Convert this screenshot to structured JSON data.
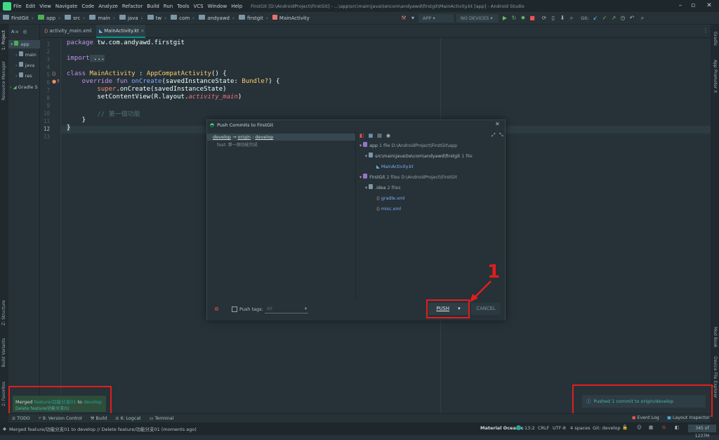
{
  "menu": {
    "items": [
      "File",
      "Edit",
      "View",
      "Navigate",
      "Code",
      "Analyze",
      "Refactor",
      "Build",
      "Run",
      "Tools",
      "VCS",
      "Window",
      "Help"
    ],
    "title": "FirstGit [D:\\AndroidProject\\FirstGit] - ...\\app\\src\\main\\java\\tw\\com\\andyawd\\firstgit\\MainActivity.kt [app] - Android Studio"
  },
  "breadcrumb": [
    "FirstGit",
    "app",
    "src",
    "main",
    "java",
    "tw",
    "com",
    "andyawd",
    "firstgit",
    "MainActivity"
  ],
  "toolbar": {
    "run_config": "APP",
    "device": "NO DEVICES",
    "git_label": "Git:"
  },
  "left_stripe": {
    "project": "1: Project",
    "resource_manager": "Resource Manager",
    "structure": "Z: Structure",
    "build_variants": "Build Variants",
    "favorites": "2: Favorites"
  },
  "right_stripe": {
    "gradle": "Gradle",
    "app_promoter": "App Promoter X",
    "modbook": "Mod Book",
    "device_file_explorer": "Device File Explorer"
  },
  "project_panel": {
    "header": "A:v",
    "items": [
      "app",
      "main",
      "java",
      "res",
      "Gradle S"
    ]
  },
  "tabs": [
    "activity_main.xml",
    "MainActivity.kt"
  ],
  "editor": {
    "line_numbers": [
      "1",
      "2",
      "3",
      "4",
      "5",
      "6",
      "7",
      "8",
      "9",
      "10",
      "11",
      "12",
      "13"
    ],
    "l1_kw": "package",
    "l1_rest": " tw.com.andyawd.firstgit",
    "l3_kw": "import",
    "l3_rest": " ...",
    "l6_kw": "class",
    "l6_cls": " MainActivity",
    "l6_rest": " : ",
    "l6_sup": "AppCompatActivity",
    "l6_end": "() {",
    "l7_kw": "    override fun",
    "l7_fn": " onCreate",
    "l7_rest": "(savedInstanceState: ",
    "l7_ty": "Bundle?",
    "l7_end": ") {",
    "l8_kw": "        super",
    "l8_rest": ".onCreate(savedInstanceState)",
    "l9_rest": "        setContentView(R.layout.",
    "l9_it": "activity_main",
    "l9_end": ")",
    "l11_cm": "        // 第一個功能",
    "l12": "    }",
    "l13": "}"
  },
  "dialog": {
    "title": "Push Commits to FirstGit",
    "branch_from": "develop",
    "branch_arrow": " → ",
    "branch_remote": "origin",
    "branch_sep": " : ",
    "branch_to": "develop",
    "commit": "feat: 第一個功能完成",
    "tree": [
      {
        "name": "app",
        "info": "1 file  D:\\AndroidProject\\FirstGit\\app"
      },
      {
        "name": "src\\main\\java\\tw\\com\\andyawd\\firstgit",
        "info": "1 file"
      },
      {
        "name": "MainActivity.kt",
        "info": ""
      },
      {
        "name": "FirstGit",
        "info": "2 files  D:\\AndroidProject\\FirstGit"
      },
      {
        "name": ".idea",
        "info": "2 files"
      },
      {
        "name": "gradle.xml",
        "info": ""
      },
      {
        "name": "misc.xml",
        "info": ""
      }
    ],
    "push_tags_label": "Push tags:",
    "push_tags_value": "All",
    "push_label": "PUSH",
    "cancel_label": "CANCEL",
    "annotation": "1"
  },
  "notification_merged": {
    "prefix": "Merged ",
    "branch": "feature/功能分支01",
    "mid": " to ",
    "target": "develop",
    "line2": "Delete feature/功能分支01"
  },
  "notification_pushed": "Pushed 1 commit to origin/develop",
  "tool_windows": [
    "TODO",
    "9: Version Control",
    "Build",
    "6: Logcat",
    "Terminal"
  ],
  "tool_windows_right": [
    "Event Log",
    "Layout Inspector"
  ],
  "status": {
    "message": "Merged feature/功能分支01 to develop // Delete feature/功能分支01 (moments ago)",
    "theme": "Material Oceanic",
    "position": "13:2",
    "line_sep": "CRLF",
    "encoding": "UTF-8",
    "indent": "4 spaces",
    "git": "Git: develop",
    "memory": "345 of 1237M"
  },
  "colors": {
    "accent": "#009688",
    "red_annotation": "#e01e1e",
    "background": "#263238"
  }
}
